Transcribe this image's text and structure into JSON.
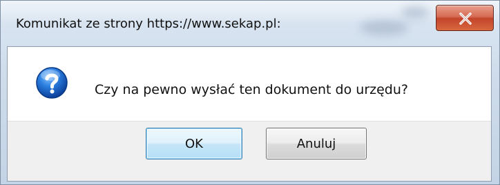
{
  "dialog": {
    "title": "Komunikat ze strony https://www.sekap.pl:",
    "message": "Czy na pewno wysłać ten dokument do urzędu?",
    "icon": "question-icon",
    "close_glyph": "X",
    "buttons": {
      "ok_label": "OK",
      "cancel_label": "Anuluj"
    }
  },
  "colors": {
    "close_button": "#c3442b",
    "ok_button_border": "#3c7fb1",
    "question_icon": "#1f6fd1"
  }
}
